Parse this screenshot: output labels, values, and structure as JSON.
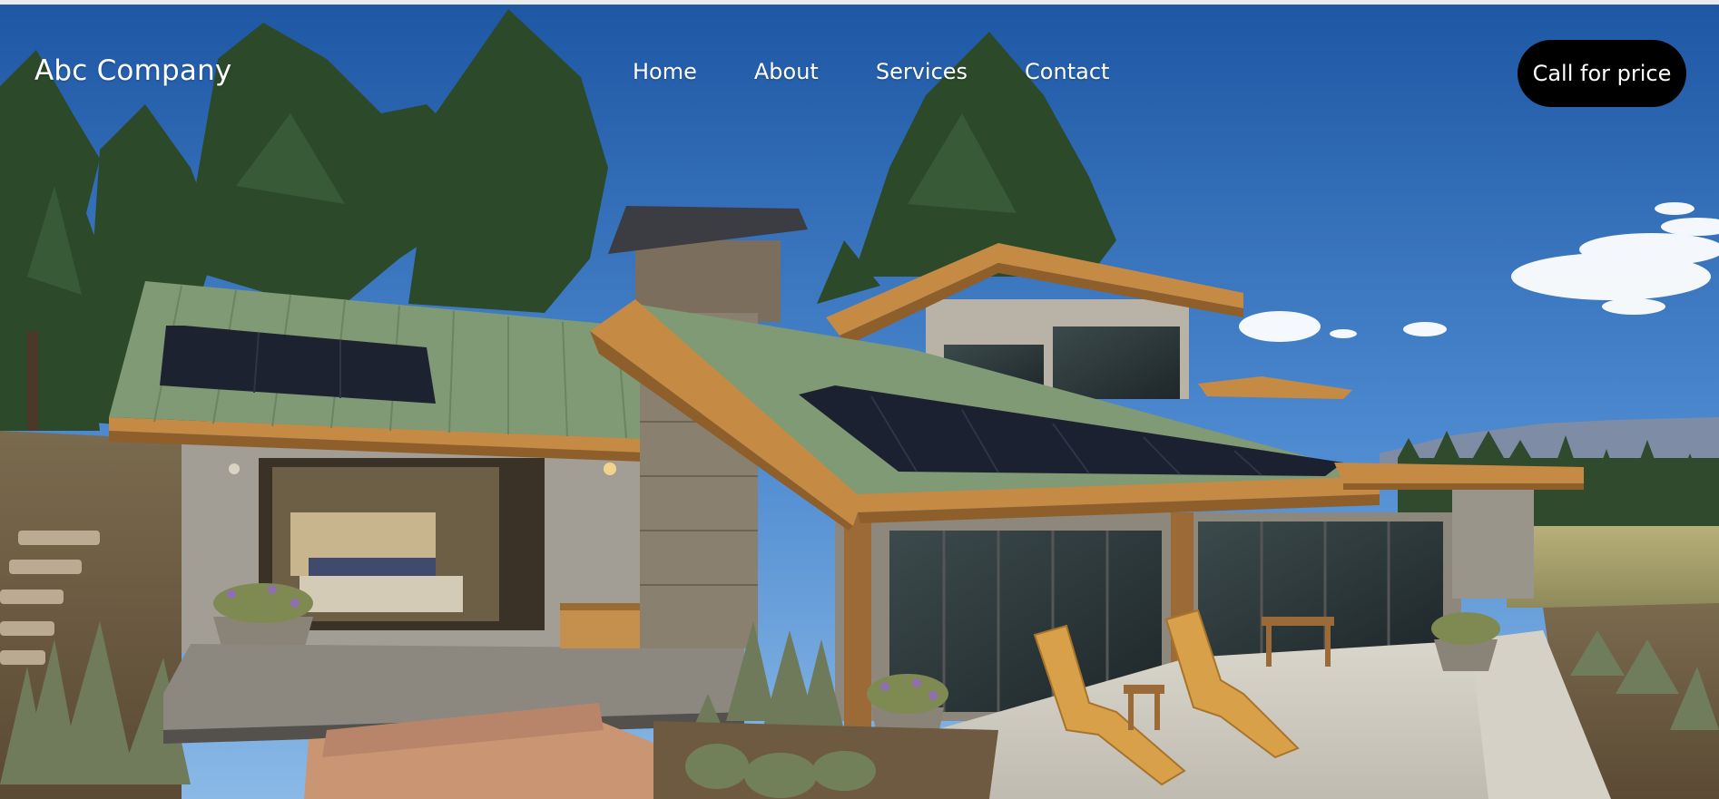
{
  "header": {
    "brand": "Abc Company",
    "nav": [
      {
        "label": "Home"
      },
      {
        "label": "About"
      },
      {
        "label": "Services"
      },
      {
        "label": "Contact"
      }
    ],
    "cta_label": "Call for price"
  },
  "hero": {
    "image_subject": "modern mountain house with green metal roof, solar panels and pine trees",
    "colors": {
      "sky_top": "#1f5ca8",
      "sky_bottom": "#6ea6dd",
      "roof": "#7f9a74",
      "timber": "#b97a3a",
      "stone": "#8a8070"
    }
  },
  "colors": {
    "text": "#ffffff",
    "cta_bg": "#000000",
    "cta_text": "#ffffff"
  }
}
